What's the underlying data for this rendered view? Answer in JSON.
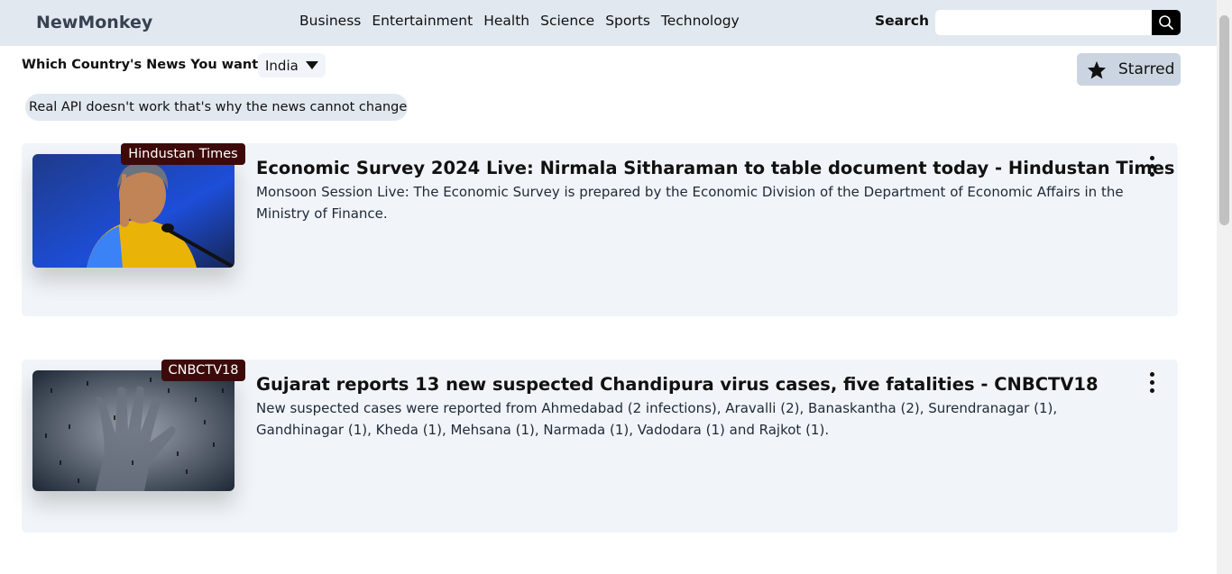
{
  "navbar": {
    "brand": "NewMonkey",
    "links": [
      "Business",
      "Entertainment",
      "Health",
      "Science",
      "Sports",
      "Technology"
    ],
    "search_label": "Search :",
    "search_value": ""
  },
  "filters": {
    "country_label": "Which Country's News You want?",
    "country_selected": "India",
    "starred_label": "Starred"
  },
  "notice": "Real API doesn't work that's why the news cannot change",
  "articles": [
    {
      "source": "Hindustan Times",
      "title": "Economic Survey 2024 Live: Nirmala Sitharaman to table document today - Hindustan Times",
      "description": "Monsoon Session Live: The Economic Survey is prepared by the Economic Division of the Department of Economic Affairs in the Ministry of Finance."
    },
    {
      "source": "CNBCTV18",
      "title": "Gujarat reports 13 new suspected Chandipura virus cases, five fatalities - CNBCTV18",
      "description": "New suspected cases were reported from Ahmedabad (2 infections), Aravalli (2), Banaskantha (2), Surendranagar (1), Gandhinagar (1), Kheda (1), Mehsana (1), Narmada (1), Vadodara (1) and Rajkot (1)."
    }
  ],
  "colors": {
    "navbar_bg": "#e2e8f0",
    "card_bg": "#f1f5f9",
    "badge_bg": "#3d0a0a",
    "starred_bg": "#cbd5e1"
  }
}
